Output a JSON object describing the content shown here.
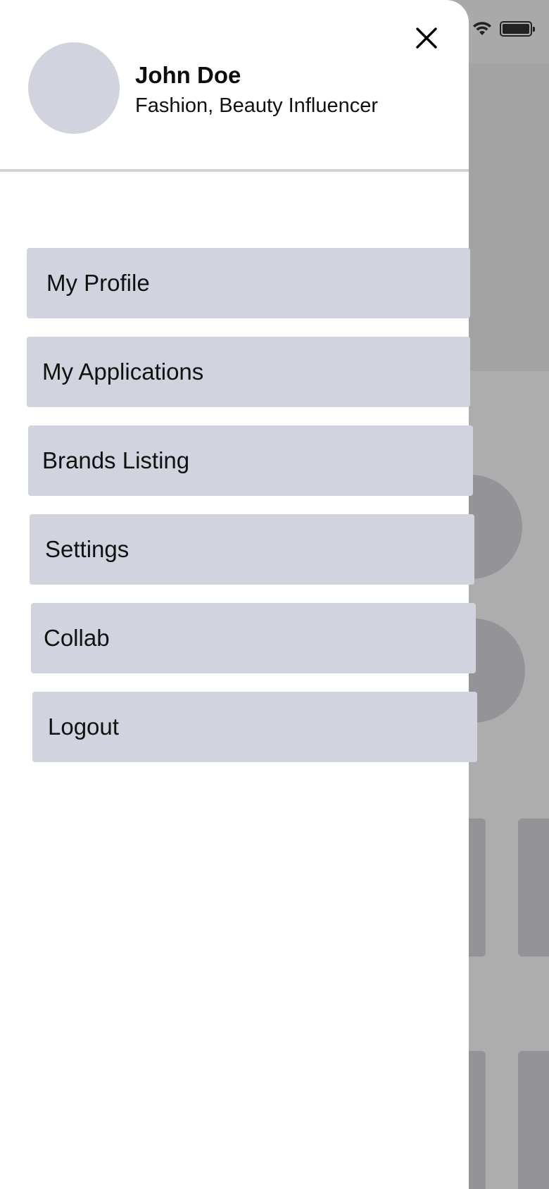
{
  "profile": {
    "name": "John Doe",
    "role": "Fashion, Beauty Influencer"
  },
  "menu": {
    "items": [
      {
        "label": "My Profile"
      },
      {
        "label": "My Applications"
      },
      {
        "label": "Brands Listing"
      },
      {
        "label": "Settings"
      },
      {
        "label": "Collab"
      },
      {
        "label": "Logout"
      }
    ]
  },
  "icons": {
    "close": "close-icon",
    "wifi": "wifi-icon",
    "battery": "battery-icon"
  },
  "colors": {
    "drawer_bg": "#ffffff",
    "menu_item_bg": "#d1d3de",
    "overlay": "#adadad"
  }
}
